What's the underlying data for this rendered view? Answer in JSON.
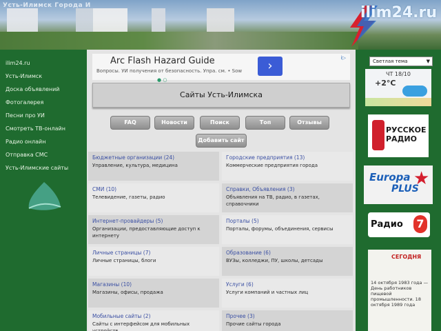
{
  "header": {
    "title_strip": "Усть-Илимск Города И",
    "logo": "ilim24.ru"
  },
  "sidebar": {
    "items": [
      {
        "label": "ilim24.ru"
      },
      {
        "label": "Усть-Илимск"
      },
      {
        "label": "Доска объявлений"
      },
      {
        "label": "Фотогалерея"
      },
      {
        "label": "Песни про УИ"
      },
      {
        "label": "Смотреть ТВ-онлайн"
      },
      {
        "label": "Радио онлайн"
      },
      {
        "label": "Отправка СМС"
      },
      {
        "label": "Усть-Илимские сайты"
      }
    ]
  },
  "ad": {
    "title": "Arc Flash Hazard Guide",
    "subtitle": "Вопросы. УИ получения от безопасность. Упра. см. • Sow",
    "button": "›",
    "info": "i▷"
  },
  "banner": {
    "text": "Сайты Усть-Илимска"
  },
  "buttons": {
    "faq": "FAQ",
    "news": "Новости",
    "search": "Поиск",
    "top": "Топ",
    "reviews": "Отзывы",
    "add_site": "Добавить сайт"
  },
  "categories": [
    {
      "title": "Бюджетные организации (24)",
      "desc": "Управление, культура, медицина"
    },
    {
      "title": "Городские предприятия (13)",
      "desc": "Коммерческие предприятия города"
    },
    {
      "title": "СМИ (10)",
      "desc": "Телевидение, газеты, радио"
    },
    {
      "title": "Справки, Объявления (3)",
      "desc": "Объявления на ТВ, радио, в газетах, справочники"
    },
    {
      "title": "Интернет-провайдеры (5)",
      "desc": "Организации, предоставляющие доступ к интернету"
    },
    {
      "title": "Порталы (5)",
      "desc": "Порталы, форумы, объединения, сервисы"
    },
    {
      "title": "Личные страницы (7)",
      "desc": "Личные страницы, блоги"
    },
    {
      "title": "Образование (6)",
      "desc": "ВУЗы, колледжи, ПУ, школы, детсады"
    },
    {
      "title": "Магазины (10)",
      "desc": "Магазины, офисы, продажа"
    },
    {
      "title": "Услуги (6)",
      "desc": "Услуги компаний и частных лиц"
    },
    {
      "title": "Мобильные сайты (2)",
      "desc": "Сайты с интерфейсом для мобильных устройств"
    },
    {
      "title": "Прочее (3)",
      "desc": "Прочие сайты города"
    }
  ],
  "right": {
    "select": "Светлая тема",
    "weather_line1": "ЧТ 18/10",
    "weather_temp": "+2°C",
    "radio1": "РУССКОЕ\nРАДИО",
    "radio2_a": "Europa",
    "radio2_b": "PLUS",
    "radio3_text": "Радио",
    "radio3_num": "7",
    "cal_title": "СЕГОДНЯ",
    "cal_text": "14 октября 1983 года — День работников пищевой промышленности. 18 октября 1989 года"
  }
}
